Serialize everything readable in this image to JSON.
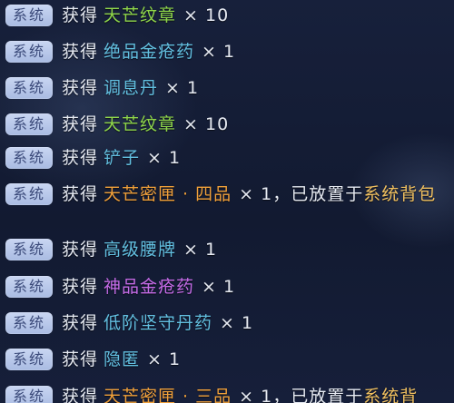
{
  "tag_label": "系统",
  "verb": "获得",
  "colors": {
    "green": "#8fd64a",
    "blue": "#62bfe0",
    "orange": "#f0a03a",
    "purple": "#c56be6",
    "gold": "#f0c060"
  },
  "rows": [
    {
      "item": "天芒纹章",
      "color": "#8fd64a",
      "qty": "× 10"
    },
    {
      "item": "绝品金疮药",
      "color": "#62bfe0",
      "qty": "× 1"
    },
    {
      "item": "调息丹",
      "color": "#62bfe0",
      "qty": "× 1"
    },
    {
      "item": "天芒纹章",
      "color": "#8fd64a",
      "qty": "× 10"
    },
    {
      "item": "铲子",
      "color": "#62bfe0",
      "qty": "× 1"
    },
    {
      "item": "天芒密匣 · 四品",
      "color": "#f0a03a",
      "qty": "× 1",
      "tail": "，已放置于",
      "dest": "系统背包"
    },
    {
      "item": "高级腰牌",
      "color": "#62bfe0",
      "qty": "× 1"
    },
    {
      "item": "神品金疮药",
      "color": "#c56be6",
      "qty": "× 1"
    },
    {
      "item": "低阶坚守丹药",
      "color": "#62bfe0",
      "qty": "× 1"
    },
    {
      "item": "隐匿",
      "color": "#62bfe0",
      "qty": "× 1"
    },
    {
      "item": "天芒密匣 · 三品",
      "color": "#f0a03a",
      "qty": "× 1",
      "tail": "，已放置于",
      "dest": "系统背"
    }
  ]
}
